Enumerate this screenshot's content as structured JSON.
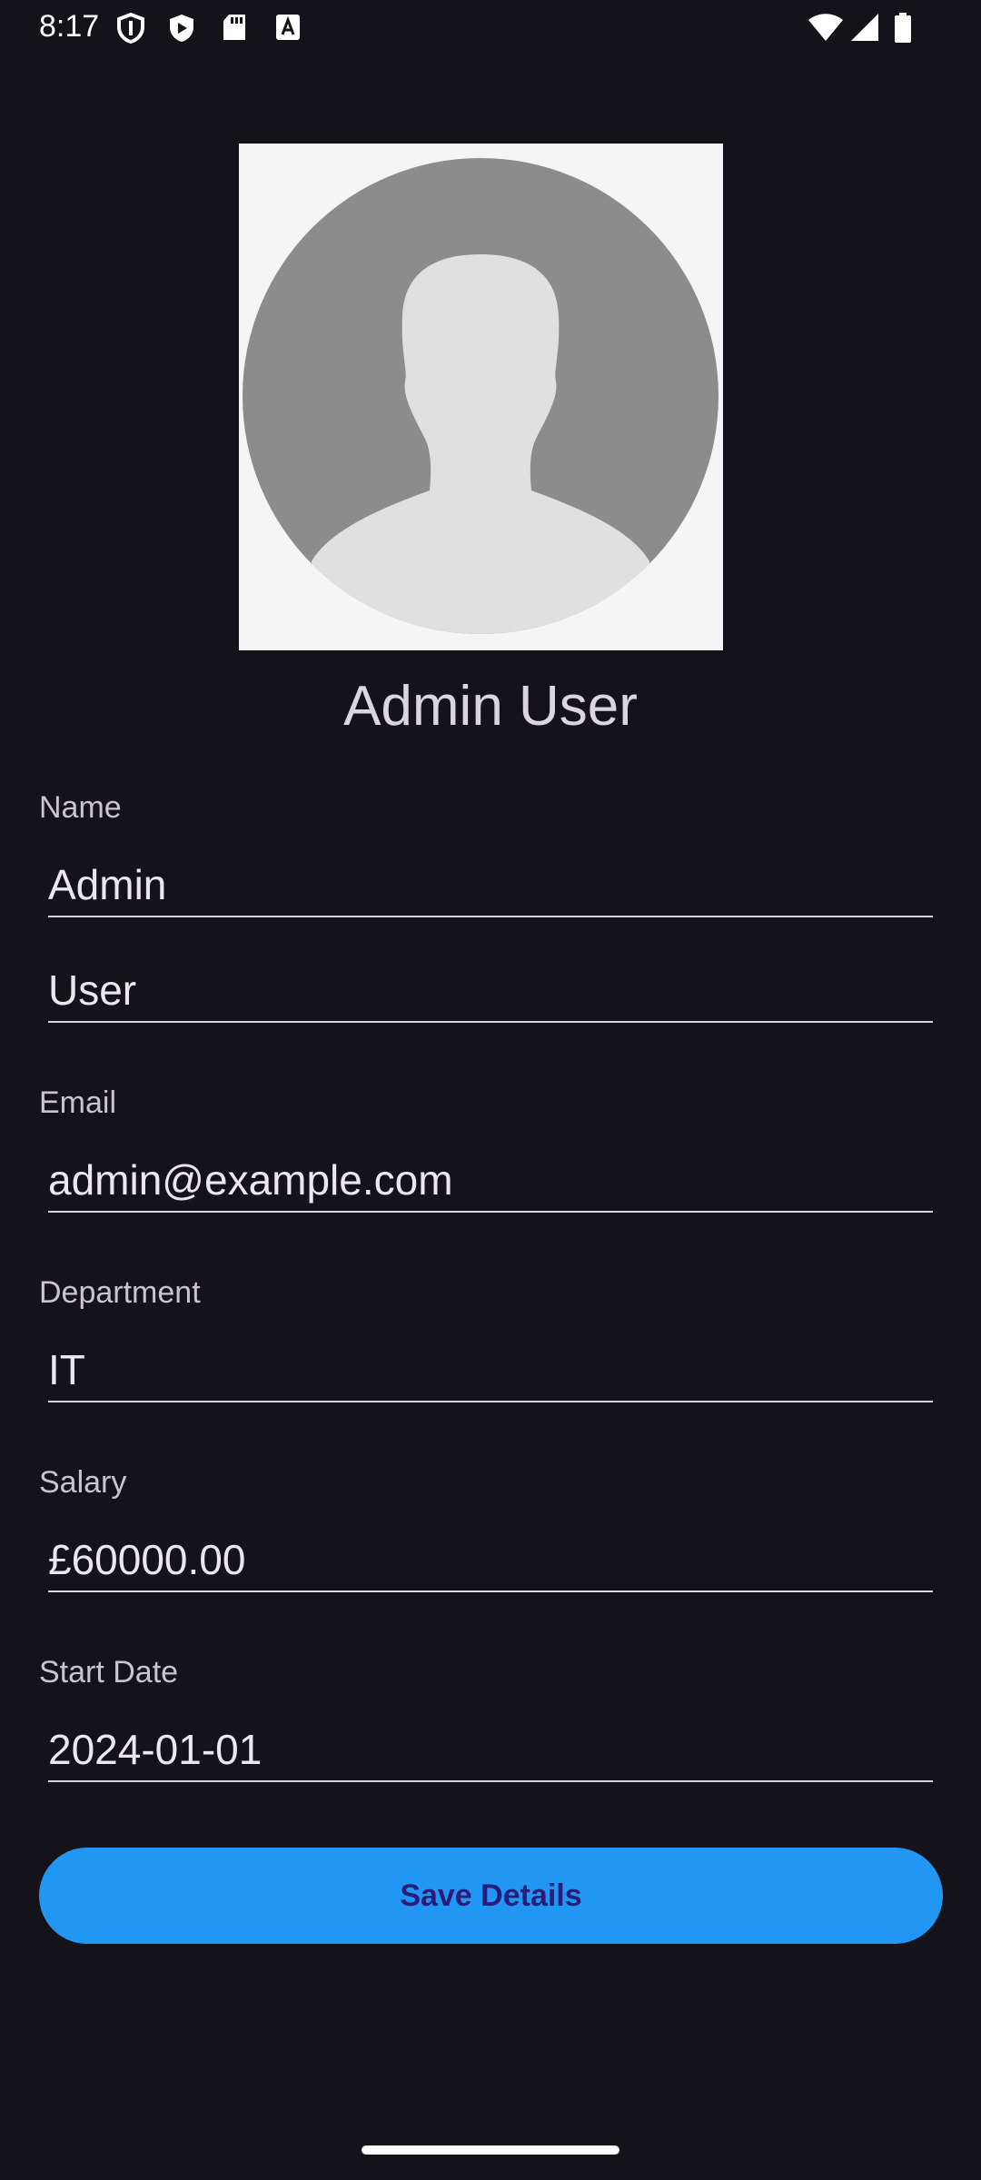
{
  "status_bar": {
    "time": "8:17",
    "left_icons": [
      "shield-icon",
      "play-protect-icon",
      "sd-card-icon",
      "a-text-icon"
    ],
    "right_icons": [
      "wifi-icon",
      "cell-signal-icon",
      "battery-icon"
    ]
  },
  "profile": {
    "display_name": "Admin User",
    "avatar_icon": "default-person-avatar-icon"
  },
  "form": {
    "name_label": "Name",
    "first_name": "Admin",
    "last_name": "User",
    "email_label": "Email",
    "email": "admin@example.com",
    "department_label": "Department",
    "department": "IT",
    "salary_label": "Salary",
    "salary": "£60000.00",
    "start_date_label": "Start Date",
    "start_date": "2024-01-01"
  },
  "actions": {
    "save_label": "Save Details"
  },
  "colors": {
    "background": "#15131a",
    "accent": "#2196f3",
    "button_text": "#2a1d7a"
  }
}
